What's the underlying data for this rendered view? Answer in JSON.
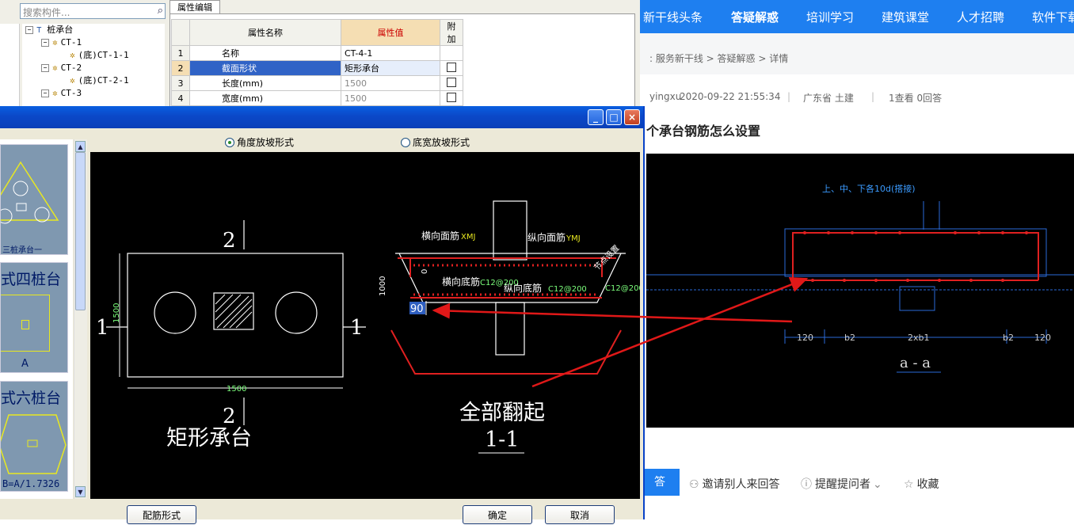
{
  "left_app": {
    "search_placeholder": "搜索构件...",
    "tree": [
      {
        "label": "桩承台",
        "level": 0,
        "toggle": "⊟"
      },
      {
        "label": "CT-1",
        "level": 1,
        "toggle": "⊟"
      },
      {
        "label": "(底)CT-1-1",
        "level": 2
      },
      {
        "label": "CT-2",
        "level": 1,
        "toggle": "⊟"
      },
      {
        "label": "(底)CT-2-1",
        "level": 2
      },
      {
        "label": "CT-3",
        "level": 1,
        "toggle": "⊟"
      }
    ],
    "property_tab": "属性编辑",
    "columns": {
      "name": "属性名称",
      "value": "属性值",
      "extra": "附加"
    },
    "rows": [
      {
        "num": "1",
        "name": "名称",
        "value": "CT-4-1",
        "checkbox": false
      },
      {
        "num": "2",
        "name": "截面形状",
        "value": "矩形承台",
        "checkbox": true
      },
      {
        "num": "3",
        "name": "长度(mm)",
        "value": "1500",
        "checkbox": true
      },
      {
        "num": "4",
        "name": "宽度(mm)",
        "value": "1500",
        "checkbox": true
      }
    ]
  },
  "web": {
    "nav": [
      "新干线头条",
      "答疑解惑",
      "培训学习",
      "建筑课堂",
      "人才招聘",
      "软件下载"
    ],
    "nav_active": "答疑解惑",
    "breadcrumb": ": 服务新干线 > 答疑解惑 > 详情",
    "user": "yingxu",
    "datetime": "2020-09-22 21:55:34",
    "region": "广东省  土建",
    "stats": "1查看  0回答",
    "question_title": "个承台钢筋怎么设置",
    "actions": {
      "answer": "答",
      "invite": "邀请别人来回答",
      "remind": "提醒提问者",
      "collect": "收藏"
    },
    "cad": {
      "top_note": "上、中、下各10d(搭接)",
      "bottom_label": "a - a",
      "dims": [
        "120",
        "b2",
        "2xb1",
        "b2",
        "120"
      ]
    }
  },
  "dialog": {
    "radio_angle": "角度放坡形式",
    "radio_width": "底宽放坡形式",
    "thumb_labels": [
      "三桩承台一",
      "式四桩台",
      "式六桩台"
    ],
    "thumb_sub": [
      "A",
      "B=A/1.7326"
    ],
    "cad_labels": {
      "section_mark": "2",
      "side_mark": "1",
      "width_dim": "1500",
      "height_dim": "1500",
      "shape_name": "矩形承台",
      "h_top": "横向面筋",
      "h_top_code": "XMJ",
      "v_top": "纵向面筋",
      "v_top_code": "YMJ",
      "h_bottom": "横向底筋",
      "h_bottom_code": "C12@200",
      "v_bottom": "纵向底筋",
      "v_bottom_code": "C12@200",
      "right_code": "C12@200",
      "slope_note": "节点设置",
      "depth": "1000",
      "angle": "90",
      "zero": "0",
      "note": "全部翻起",
      "section": "1-1"
    },
    "buttons": {
      "rebar": "配筋形式",
      "ok": "确定",
      "cancel": "取消"
    },
    "window_buttons": [
      "_",
      "□",
      "×"
    ]
  }
}
